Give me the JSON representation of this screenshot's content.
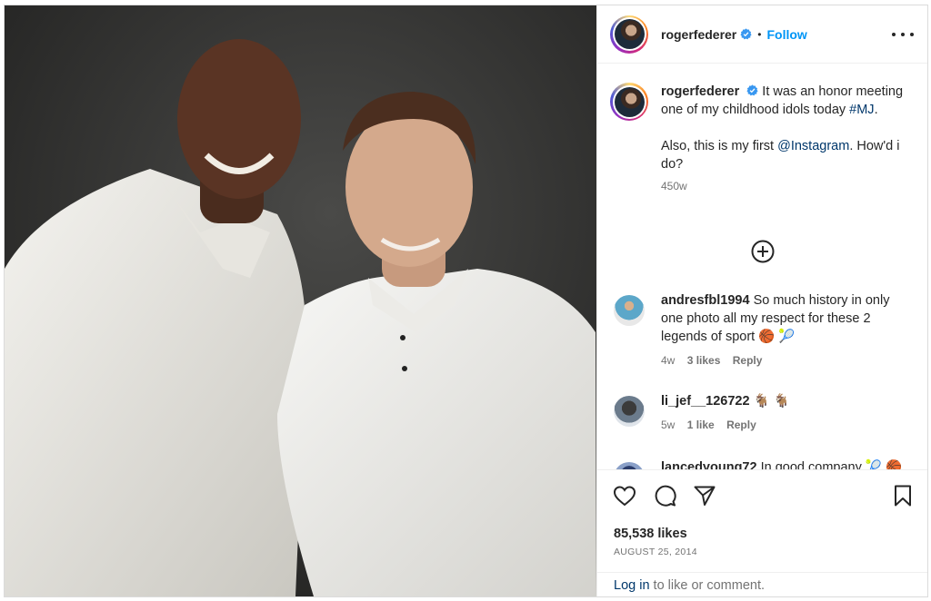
{
  "post": {
    "username": "rogerfederer",
    "follow_label": "Follow",
    "separator": "•",
    "caption_line1": "It was an honor meeting one of my childhood idols today ",
    "caption_hashtag": "#MJ",
    "caption_line1_end": ".",
    "caption_line2": "Also, this is my first ",
    "caption_mention": "@Instagram",
    "caption_line2_end": ". How'd i do?",
    "caption_age": "450w",
    "likes": "85,538 likes",
    "date": "AUGUST 25, 2014",
    "login_link": "Log in",
    "login_rest": " to like or comment."
  },
  "comments": [
    {
      "username": "andresfbl1994",
      "text": "So much history in only one photo all my respect for these 2 legends of sport 🏀 🎾",
      "age": "4w",
      "likes": "3 likes",
      "reply": "Reply"
    },
    {
      "username": "li_jef__126722",
      "text": "🐐 🐐",
      "age": "5w",
      "likes": "1 like",
      "reply": "Reply"
    },
    {
      "username": "lancedyoung72",
      "text": "In good company 🎾 🏀"
    }
  ],
  "colors": {
    "accent": "#0095f6",
    "link": "#00376b",
    "muted": "#737373",
    "verified": "#3897f0"
  },
  "icons": [
    "verified-badge-icon",
    "more-options-icon",
    "load-more-comments-icon",
    "heart-icon",
    "comment-icon",
    "share-icon",
    "bookmark-icon"
  ]
}
